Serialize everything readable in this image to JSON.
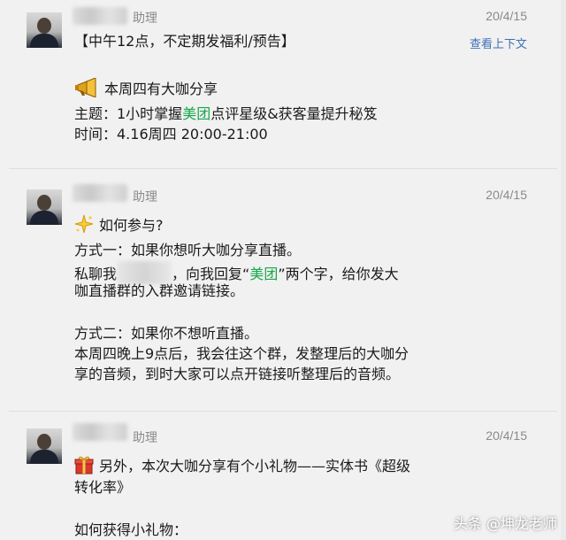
{
  "messages": [
    {
      "sender": "助理",
      "time": "20/4/15",
      "context_link": "查看上下文",
      "lines": {
        "l1": "【中午12点，不定期发福利/预告】",
        "l2": "本周四有大咖分享",
        "l3a": "主题：1小时掌握",
        "l3b": "美团",
        "l3c": "点评星级&获客量提升秘笈",
        "l4": "时间：4.16周四  20:00-21:00"
      }
    },
    {
      "sender": "助理",
      "time": "20/4/15",
      "lines": {
        "l1": "如何参与?",
        "l2": "方式一：如果你想听大咖分享直播。",
        "l3a": "私聊我",
        "l3b": "，向我回复“",
        "l3c": "美团",
        "l3d": "”两个字，给你发大",
        "l4": "咖直播群的入群邀请链接。",
        "l5": "方式二：如果你不想听直播。",
        "l6": "本周四晚上9点后，我会往这个群，发整理后的大咖分",
        "l7": "享的音频，到时大家可以点开链接听整理后的音频。"
      }
    },
    {
      "sender": "助理",
      "time": "20/4/15",
      "lines": {
        "l1": "另外，本次大咖分享有个小礼物——实体书《超级",
        "l2": "转化率》",
        "l3": "如何获得小礼物："
      }
    }
  ],
  "watermark": "头条 @坤龙老师",
  "icons": {
    "megaphone": "megaphone-icon",
    "sparkle": "sparkle-icon",
    "gift": "gift-icon"
  },
  "colors": {
    "highlight_green": "#18a84a",
    "link_blue": "#3e6fb5",
    "meta_gray": "#8a8a8a"
  }
}
